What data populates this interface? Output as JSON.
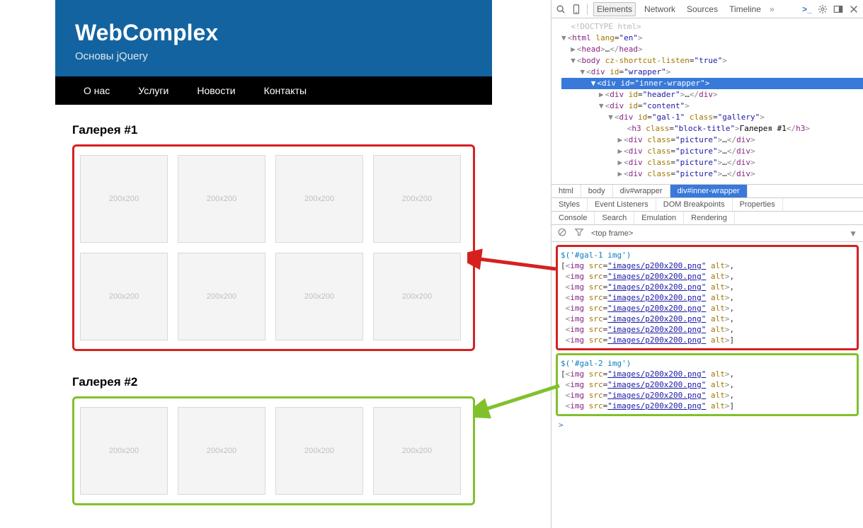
{
  "page": {
    "title": "WebComplex",
    "subtitle": "Основы jQuery",
    "nav": [
      "О нас",
      "Услуги",
      "Новости",
      "Контакты"
    ],
    "placeholder_label": "200x200",
    "galleries": [
      {
        "title": "Галерея #1",
        "id": "gal-1",
        "count": 8
      },
      {
        "title": "Галерея #2",
        "id": "gal-2",
        "count": 4
      }
    ]
  },
  "devtools": {
    "tabs": {
      "elements": "Elements",
      "network": "Network",
      "sources": "Sources",
      "timeline": "Timeline",
      "more": "»"
    },
    "breadcrumb": [
      "html",
      "body",
      "div#wrapper",
      "div#inner-wrapper"
    ],
    "styles_tabs": [
      "Styles",
      "Event Listeners",
      "DOM Breakpoints",
      "Properties"
    ],
    "console_tabs": [
      "Console",
      "Search",
      "Emulation",
      "Rendering"
    ],
    "frame_label": "<top frame>",
    "dom": {
      "doctype": "<!DOCTYPE html>",
      "html_open": "<html lang=\"en\">",
      "head": "<head>…</head>",
      "body_open": "<body cz-shortcut-listen=\"true\">",
      "wrapper": "<div id=\"wrapper\">",
      "inner_wrapper": "<div id=\"inner-wrapper\">",
      "header": "<div id=\"header\">…</div>",
      "content": "<div id=\"content\">",
      "gal1": "<div id=\"gal-1\" class=\"gallery\">",
      "h3": "<h3 class=\"block-title\">Галерея #1</h3>",
      "picture": "<div class=\"picture\">…</div>"
    },
    "console_entries": [
      {
        "color": "red",
        "query": "$('#gal-1 img')",
        "results": 8,
        "img_line": "<img src=\"images/p200x200.png\" alt>"
      },
      {
        "color": "green",
        "query": "$('#gal-2 img')",
        "results": 4,
        "img_line": "<img src=\"images/p200x200.png\" alt>"
      }
    ]
  }
}
